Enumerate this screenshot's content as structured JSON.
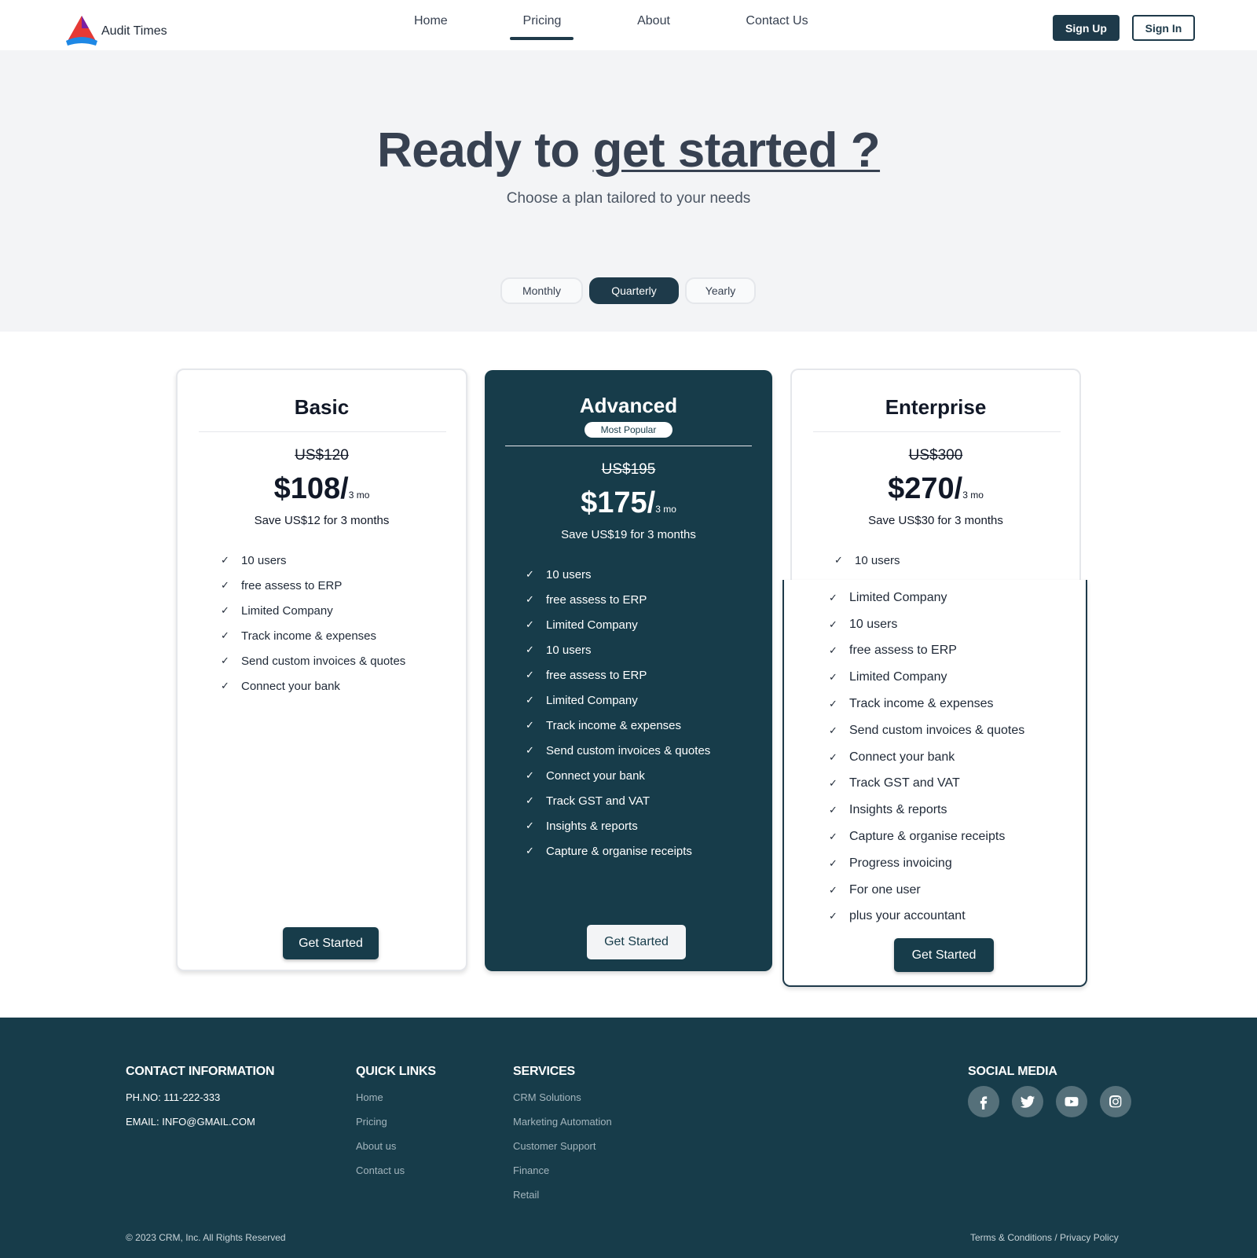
{
  "brand": {
    "name": "Audit Times"
  },
  "nav": {
    "items": [
      "Home",
      "Pricing",
      "About",
      "Contact Us"
    ],
    "active": "Pricing"
  },
  "auth": {
    "signup": "Sign Up",
    "signin": "Sign In"
  },
  "hero": {
    "title_plain": "Ready to ",
    "title_underlined": "get started ?",
    "subtitle": "Choose a plan tailored to your needs"
  },
  "billing": {
    "options": [
      "Monthly",
      "Quarterly",
      "Yearly"
    ],
    "selected": "Quarterly"
  },
  "plans": [
    {
      "name": "Basic",
      "old_price": "US$120",
      "price": "$108/",
      "period": "3 mo",
      "save": "Save US$12 for 3 months",
      "features": [
        "10 users",
        "free assess to ERP",
        "Limited Company",
        "Track income & expenses",
        "Send custom invoices & quotes",
        "Connect your bank"
      ],
      "cta": "Get Started"
    },
    {
      "name": "Advanced",
      "badge": "Most Popular",
      "old_price": "US$195",
      "price": "$175/",
      "period": "3 mo",
      "save": "Save US$19 for 3 months",
      "features": [
        "10 users",
        "free assess to ERP",
        "Limited Company",
        "10 users",
        "free assess to ERP",
        "Limited Company",
        "Track income & expenses",
        "Send custom invoices & quotes",
        "Connect your bank",
        "Track GST and VAT",
        "Insights & reports",
        "Capture & organise receipts"
      ],
      "cta": "Get Started"
    },
    {
      "name": "Enterprise",
      "old_price": "US$300",
      "price": "$270/",
      "period": "3 mo",
      "save": "Save US$30 for 3 months",
      "features_top": [
        "10 users",
        "free assess to ERP"
      ],
      "features": [
        "Limited Company",
        "10 users",
        "free assess to ERP",
        "Limited Company",
        "Track income & expenses",
        "Send custom invoices & quotes",
        "Connect your bank",
        "Track GST and VAT",
        "Insights & reports",
        "Capture & organise receipts",
        "Progress invoicing",
        "For one user",
        "plus your accountant"
      ],
      "cta": "Get Started"
    }
  ],
  "footer": {
    "contact": {
      "heading": "CONTACT INFORMATION",
      "phone": "PH.NO: 111-222-333",
      "email": "EMAIL: INFO@GMAIL.COM"
    },
    "quick_links": {
      "heading": "QUICK LINKS",
      "items": [
        "Home",
        "Pricing",
        "About us",
        "Contact us"
      ]
    },
    "services": {
      "heading": "SERVICES",
      "items": [
        "CRM Solutions",
        "Marketing Automation",
        "Customer Support",
        "Finance",
        "Retail"
      ]
    },
    "social": {
      "heading": "SOCIAL MEDIA",
      "icons": [
        "facebook-icon",
        "twitter-icon",
        "youtube-icon",
        "instagram-icon"
      ]
    },
    "copyright": "© 2023 CRM, Inc. All Rights Reserved",
    "legal": "Terms & Conditions / Privacy Policy"
  },
  "colors": {
    "primary": "#173c4a",
    "hero_bg": "#f3f4f6",
    "text": "#374151"
  }
}
